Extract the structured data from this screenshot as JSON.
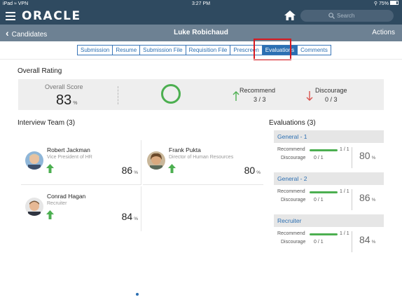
{
  "status_bar": {
    "device": "iPad",
    "network": "VPN",
    "time": "3:27 PM",
    "battery": "75%"
  },
  "app": {
    "logo_text": "ORACLE",
    "search_placeholder": "Search"
  },
  "nav": {
    "back_label": "Candidates",
    "title": "Luke  Robichaud",
    "actions_label": "Actions"
  },
  "tabs": [
    {
      "label": "Submission",
      "active": false
    },
    {
      "label": "Resume",
      "active": false
    },
    {
      "label": "Submission File",
      "active": false
    },
    {
      "label": "Requisition File",
      "active": false
    },
    {
      "label": "Prescreen",
      "active": false
    },
    {
      "label": "Evaluations",
      "active": true
    },
    {
      "label": "Comments",
      "active": false
    }
  ],
  "overall": {
    "heading": "Overall Rating",
    "score_label": "Overall Score",
    "score_value": "83",
    "score_unit": "%",
    "recommend_label": "Recommend",
    "recommend_value": "3 / 3",
    "discourage_label": "Discourage",
    "discourage_value": "0 / 3"
  },
  "team": {
    "heading": "Interview Team (3)",
    "members": [
      {
        "name": "Robert Jackman",
        "title": "Vice President of HR",
        "score": "86",
        "unit": "%"
      },
      {
        "name": "Frank Pukta",
        "title": "Director of Human Resources",
        "score": "80",
        "unit": "%"
      },
      {
        "name": "Conrad Hagan",
        "title": "Recruiter",
        "score": "84",
        "unit": "%"
      }
    ]
  },
  "evaluations": {
    "heading": "Evaluations (3)",
    "items": [
      {
        "name": "General - 1",
        "recommend_label": "Recommend",
        "recommend_value": "1 / 1",
        "discourage_label": "Discourage",
        "discourage_value": "0 / 1",
        "score": "80",
        "unit": "%"
      },
      {
        "name": "General - 2",
        "recommend_label": "Recommend",
        "recommend_value": "1 / 1",
        "discourage_label": "Discourage",
        "discourage_value": "0 / 1",
        "score": "86",
        "unit": "%"
      },
      {
        "name": "Recruiter",
        "recommend_label": "Recommend",
        "recommend_value": "1 / 1",
        "discourage_label": "Discourage",
        "discourage_value": "0 / 1",
        "score": "84",
        "unit": "%"
      }
    ]
  },
  "colors": {
    "header": "#2f4a60",
    "navbar": "#6d8193",
    "accent": "#2c6fb2",
    "positive": "#4caf50",
    "negative": "#d9534f",
    "highlight": "#d71920"
  },
  "icons": [
    "hamburger-menu-icon",
    "home-icon",
    "search-icon",
    "back-chevron-icon",
    "recommend-arrow-icon",
    "discourage-arrow-icon",
    "thumbs-up-arrow-icon"
  ]
}
